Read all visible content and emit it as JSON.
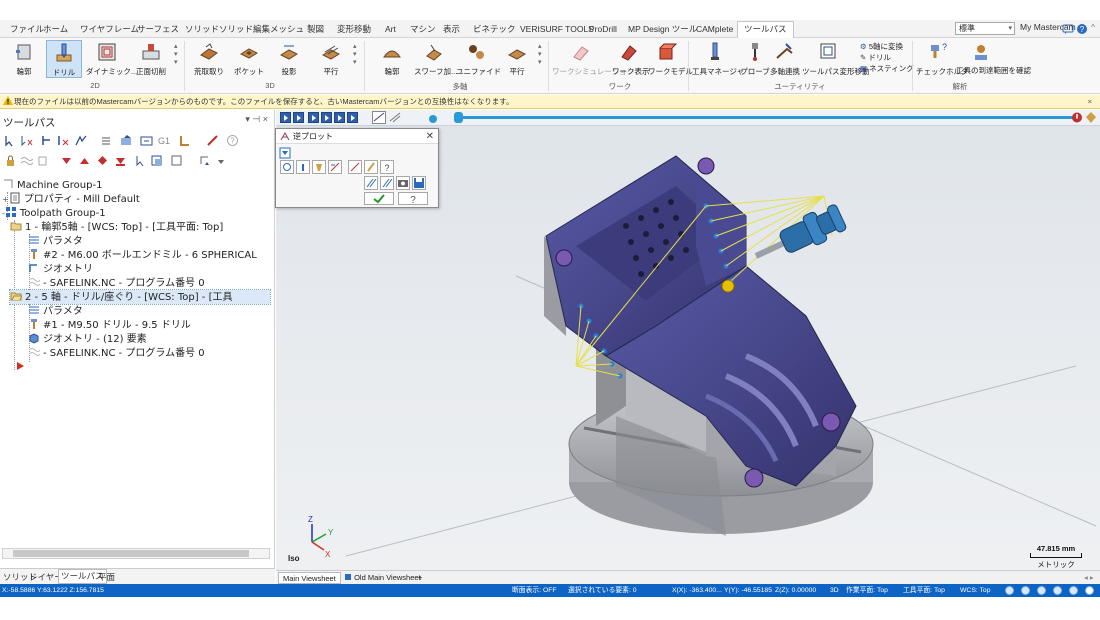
{
  "menu": {
    "tabs": [
      "ファイル",
      "ホーム",
      "ワイヤフレーム",
      "サーフェス",
      "ソリッド",
      "ソリッド編集",
      "メッシュ",
      "製図",
      "変形移動",
      "Art",
      "マシン",
      "表示",
      "ビネテック",
      "VERISURF TOOLS",
      "ProDrill",
      "MP Design ツール",
      "CAMplete",
      "ツールパス"
    ],
    "active_tab": "ツールパス",
    "combo_value": "標準",
    "my_label": "My Mastercam"
  },
  "ribbon": {
    "buttons_2d": [
      "輪郭",
      "ドリル",
      "ダイナミック...",
      "正面切削"
    ],
    "buttons_3d": [
      "荒取取り",
      "ポケット",
      "投影",
      "平行"
    ],
    "buttons_multi": [
      "輪郭",
      "スワーフ加...",
      "ユニファイド",
      "平行"
    ],
    "buttons_work": [
      "ワークシミュレーション",
      "ワーク表示",
      "ワークモデル"
    ],
    "buttons_util": [
      "工具マネージャ",
      "プローブ",
      "多軸連携",
      "ツールパス変形移動"
    ],
    "util_small": [
      "5軸に変換",
      "ドリル",
      "ネスティング"
    ],
    "buttons_analysis": [
      "チェックホルダ",
      "工具の到達範囲を確認"
    ],
    "groups": [
      "2D",
      "3D",
      "多軸",
      "ワーク",
      "ユーティリティ",
      "解析"
    ],
    "selected_button": "ドリル"
  },
  "warning": {
    "text": "現在のファイルは以前のMastercamバージョンからのものです。このファイルを保存すると、古いMastercamバージョンとの互換性はなくなります。"
  },
  "toolpath_panel": {
    "title": "ツールパス",
    "tree": [
      {
        "id": "machine_group",
        "label": "Machine Group-1"
      },
      {
        "id": "properties",
        "label": "プロパティ - Mill Default"
      },
      {
        "id": "toolpath_group",
        "label": "Toolpath Group-1"
      },
      {
        "id": "op1",
        "label": "1 - 輪郭5軸 - [WCS: Top] - [工具平面: Top]"
      },
      {
        "id": "op1_params",
        "label": "パラメタ"
      },
      {
        "id": "op1_tool",
        "label": "#2 - M6.00 ボールエンドミル - 6 SPHERICAL"
      },
      {
        "id": "op1_geom",
        "label": "ジオメトリ"
      },
      {
        "id": "op1_nc",
        "label": "- SAFELINK.NC - プログラム番号 0"
      },
      {
        "id": "op2",
        "label": "2 - 5 軸 - ドリル/座ぐり - [WCS: Top] - [工具"
      },
      {
        "id": "op2_params",
        "label": "パラメタ"
      },
      {
        "id": "op2_tool",
        "label": "#1 - M9.50 ドリル - 9.5 ドリル"
      },
      {
        "id": "op2_geom",
        "label": "ジオメトリ - (12) 要素"
      },
      {
        "id": "op2_nc",
        "label": "- SAFELINK.NC - プログラム番号 0"
      }
    ],
    "bottom_tabs": [
      "ソリッド",
      "レイヤー",
      "ツールパス",
      "平面"
    ],
    "active_bottom_tab": "ツールパス"
  },
  "backplot_dialog": {
    "title": "逆プロット"
  },
  "viewport": {
    "view_name": "Iso",
    "scale_value": "47.815 mm",
    "scale_unit": "メトリック",
    "tabs": [
      "Main Viewsheet",
      "Old Main Viewsheet"
    ],
    "add_tab": "+",
    "active_tab": "Main Viewsheet",
    "axis_x": "X",
    "axis_y": "Y",
    "axis_z": "Z"
  },
  "status": {
    "coords": "X:-58.5886  Y:63.1222  Z:156.7815",
    "section_view": "断面表示: OFF",
    "selected": "選択されている要素: 0",
    "x": "X(X): -363.400...",
    "y": "Y(Y): -46.55185",
    "z": "Z(Z): 0.00000",
    "mode": "3D",
    "work_plane": "作業平面: Top",
    "tool_plane": "工具平面: Top",
    "wcs": "WCS: Top"
  },
  "colors": {
    "part": "#4b4b92",
    "accent": "#0e64c4",
    "toolpath": "#e6e04a",
    "tool": "#2c6fa8"
  }
}
